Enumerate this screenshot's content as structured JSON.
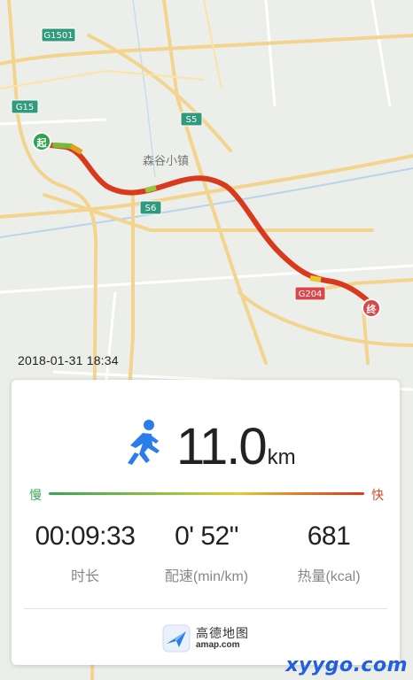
{
  "map": {
    "road_shields": {
      "g1501": "G1501",
      "g15": "G15",
      "s5": "S5",
      "s6": "S6",
      "g204": "G204"
    },
    "place_label": "森谷小镇",
    "start_marker": "起",
    "end_marker": "终"
  },
  "run": {
    "timestamp": "2018-01-31   18:34",
    "distance_value": "11.0",
    "distance_unit": "km",
    "speed_scale": {
      "slow_label": "慢",
      "fast_label": "快"
    },
    "stats": [
      {
        "value": "00:09:33",
        "label": "时长"
      },
      {
        "value": "0' 52\"",
        "label": "配速(min/km)"
      },
      {
        "value": "681",
        "label": "热量(kcal)"
      }
    ]
  },
  "brand": {
    "name": "高德地图",
    "url": "amap.com"
  },
  "watermark": "xyygo.com",
  "colors": {
    "route": "#d93a1e",
    "slow": "#33a853",
    "fast": "#d93a1e",
    "runner_icon": "#2b7de9",
    "shield_green": "#2f9a7c",
    "shield_red": "#d8474a",
    "watermark": "#1f5fe0"
  }
}
